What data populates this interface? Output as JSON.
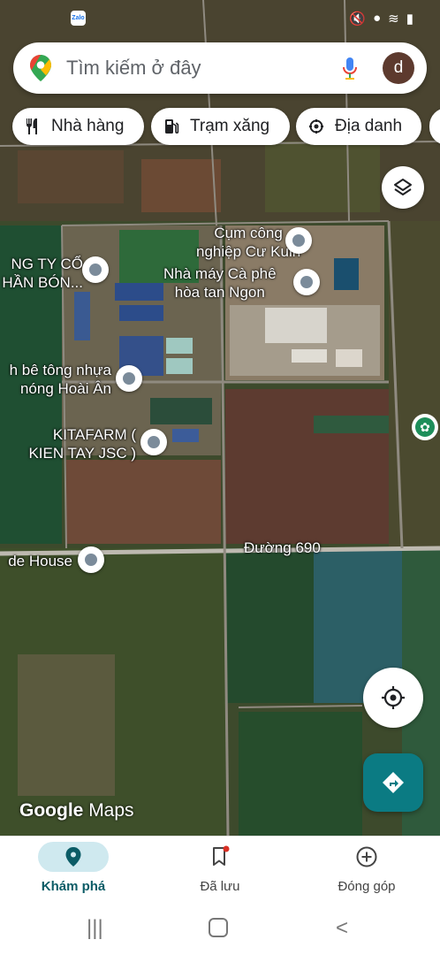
{
  "status_bar": {
    "app_icon": "Zalo",
    "icons": [
      "mute-icon",
      "location-icon",
      "wifi-icon",
      "battery-icon"
    ]
  },
  "search": {
    "placeholder": "Tìm kiếm ở đây",
    "avatar_letter": "d"
  },
  "chips": [
    {
      "label": "Nhà hàng",
      "icon": "restaurant-icon"
    },
    {
      "label": "Trạm xăng",
      "icon": "gas-station-icon"
    },
    {
      "label": "Địa danh",
      "icon": "landmark-icon"
    }
  ],
  "places": [
    {
      "line1": "Cụm công",
      "line2": "nghiệp Cư Kuin"
    },
    {
      "line1": "Nhà máy Cà phê",
      "line2": "hòa tan Ngon"
    },
    {
      "line1": "NG TY CỔ",
      "line2": "HẦN BÓN..."
    },
    {
      "line1": "h bê tông nhựa",
      "line2": "nóng Hoài Ân"
    },
    {
      "line1": "KITAFARM (",
      "line2": "KIEN TAY JSC )"
    },
    {
      "line1": "de House",
      "line2": ""
    }
  ],
  "road": "Đường 690",
  "attribution": {
    "google": "Google",
    "maps": "Maps"
  },
  "bottom_nav": [
    {
      "label": "Khám phá",
      "icon": "explore-pin-icon",
      "active": true
    },
    {
      "label": "Đã lưu",
      "icon": "bookmark-icon",
      "active": false
    },
    {
      "label": "Đóng góp",
      "icon": "add-circle-icon",
      "active": false
    }
  ],
  "colors": {
    "accent": "#0b7b83",
    "active_tab_bg": "#cfe9ef"
  }
}
